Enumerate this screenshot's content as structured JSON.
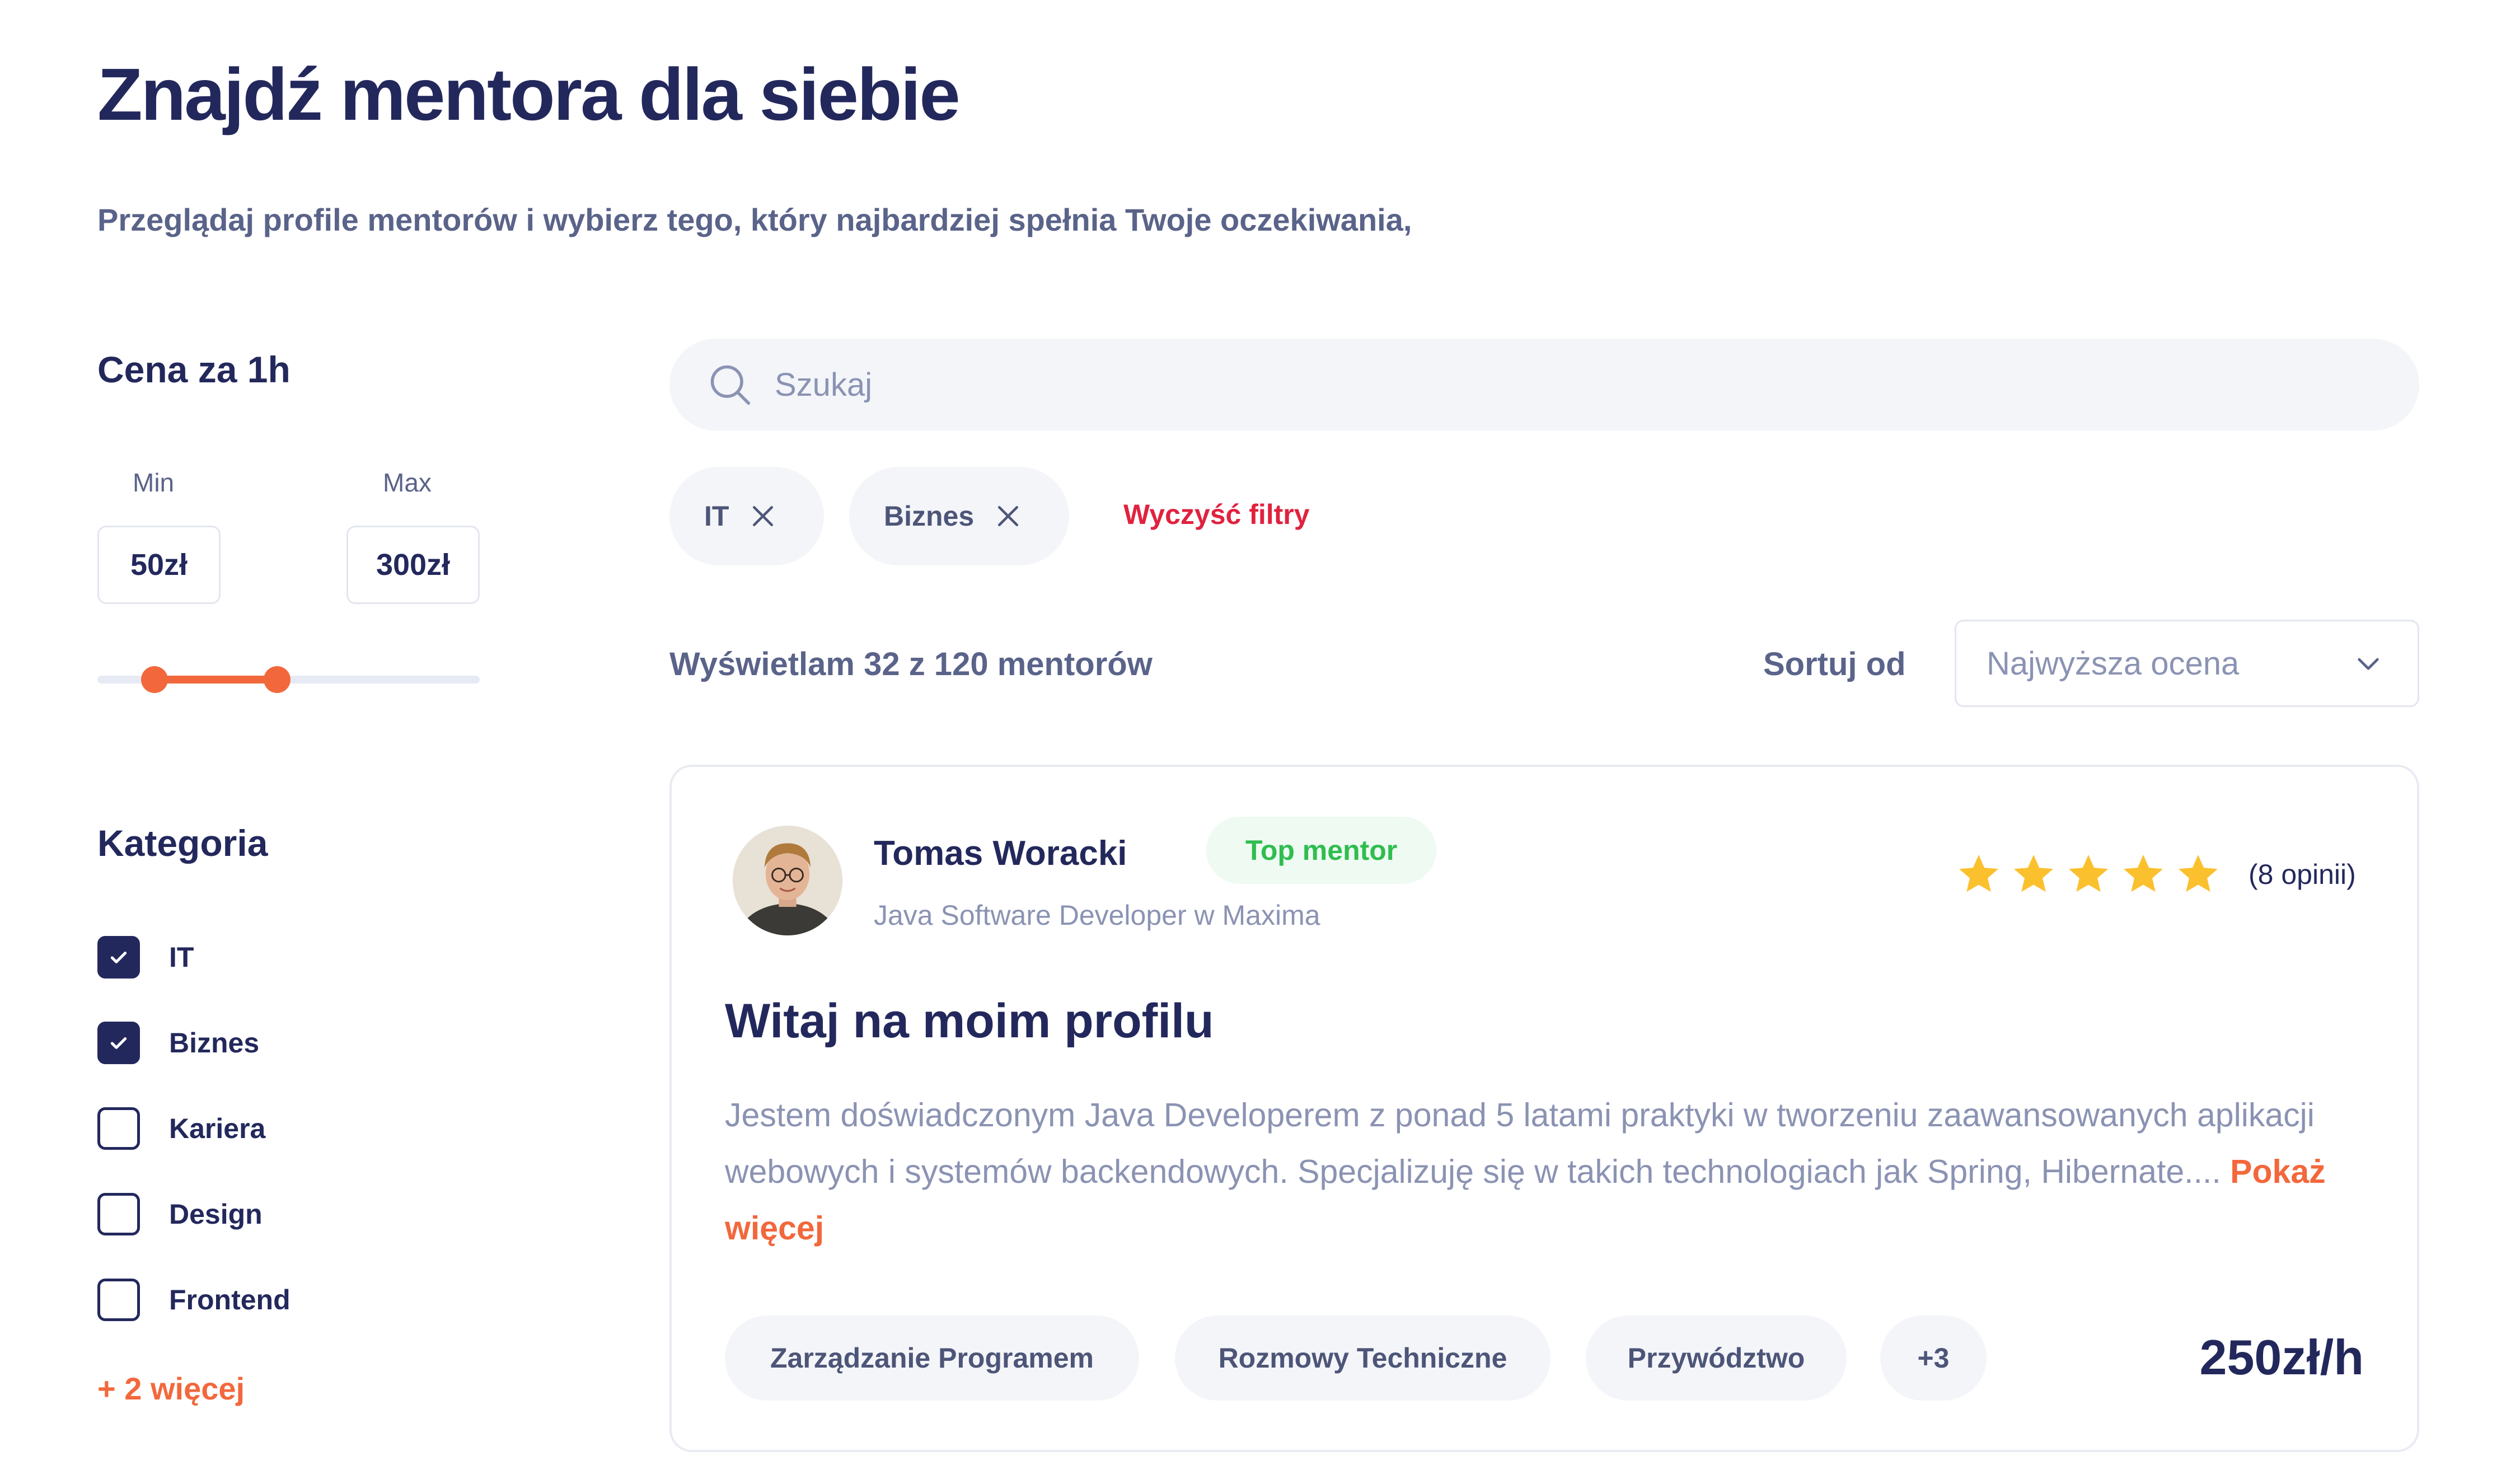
{
  "header": {
    "title": "Znajdź mentora dla siebie",
    "subtitle": "Przeglądaj profile mentorów i wybierz tego, który najbardziej spełnia Twoje oczekiwania,"
  },
  "price_filter": {
    "heading": "Cena za 1h",
    "min_label": "Min",
    "max_label": "Max",
    "min_value": "50zł",
    "max_value": "300zł",
    "slider_range_fraction": [
      0.15,
      0.47
    ]
  },
  "category_filter": {
    "heading": "Kategoria",
    "items": [
      {
        "label": "IT",
        "checked": true
      },
      {
        "label": "Biznes",
        "checked": true
      },
      {
        "label": "Kariera",
        "checked": false
      },
      {
        "label": "Design",
        "checked": false
      },
      {
        "label": "Frontend",
        "checked": false
      }
    ],
    "more_label": "+ 2 więcej"
  },
  "search": {
    "placeholder": "Szukaj",
    "icon": "search-icon"
  },
  "active_filters": {
    "chips": [
      {
        "label": "IT",
        "icon": "close-icon"
      },
      {
        "label": "Biznes",
        "icon": "close-icon"
      }
    ],
    "clear_label": "Wyczyść filtry"
  },
  "results": {
    "count_text": "Wyświetlam 32 z 120 mentorów",
    "sort_label": "Sortuj od",
    "sort_value": "Najwyższa ocena",
    "sort_icon": "chevron-down-icon"
  },
  "mentor": {
    "name": "Tomas Woracki",
    "badge": "Top mentor",
    "role": "Java Software Developer w Maxima",
    "rating_stars": 5,
    "reviews": "(8 opinii)",
    "title": "Witaj na moim profilu",
    "description": "Jestem doświadczonym Java Developerem z ponad 5 latami praktyki w tworzeniu zaawansowanych aplikacji webowych i systemów backendowych. Specjalizuję się w takich technologiach jak Spring, Hibernate....",
    "show_more": "Pokaż więcej",
    "tags": [
      "Zarządzanie Programem",
      "Rozmowy Techniczne",
      "Przywództwo",
      "+3"
    ],
    "price": "250zł/h"
  },
  "colors": {
    "primary": "#23285c",
    "accent": "#f2683c",
    "danger": "#e0223f",
    "success": "#2fbd4f",
    "star": "#fbc02d"
  }
}
